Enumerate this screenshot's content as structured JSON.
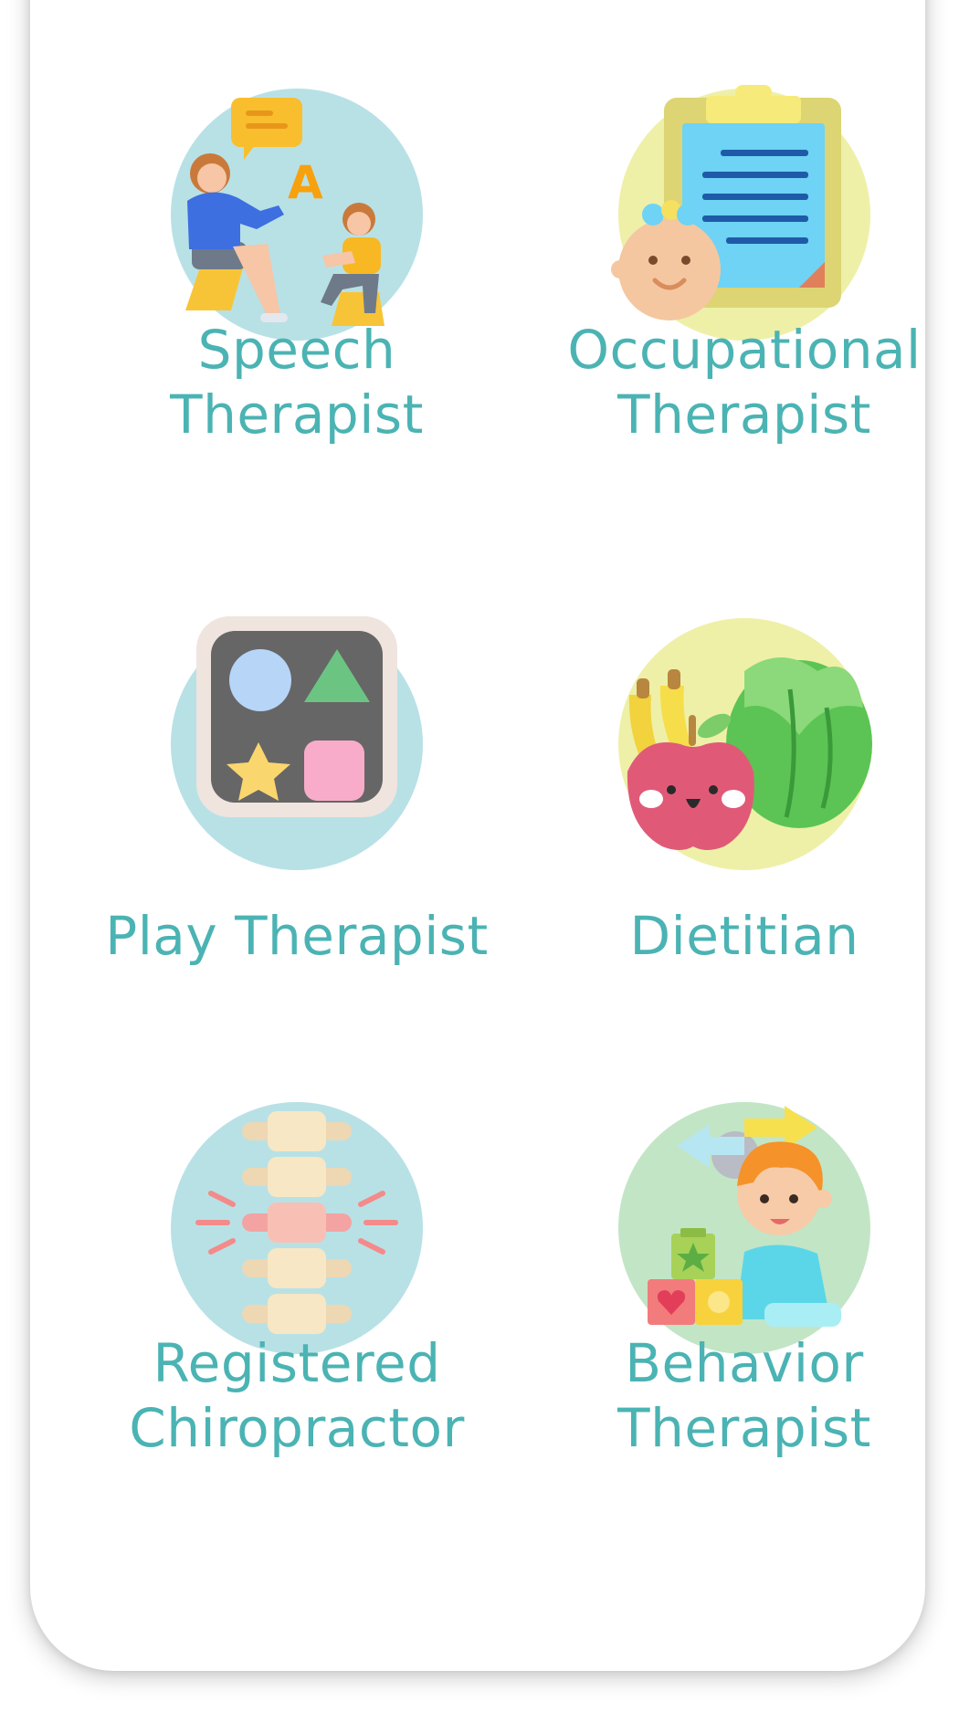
{
  "colors": {
    "label": "#4bb3b3",
    "card": "#ffffff"
  },
  "therapists": [
    {
      "icon": "speech-therapist-icon",
      "line1": "Speech",
      "line2": "Therapist"
    },
    {
      "icon": "occupational-therapist-icon",
      "line1": "Occupational",
      "line2": "Therapist"
    },
    {
      "icon": "play-therapist-icon",
      "line1": "Play Therapist",
      "line2": ""
    },
    {
      "icon": "dietitian-icon",
      "line1": "Dietitian",
      "line2": ""
    },
    {
      "icon": "chiropractor-icon",
      "line1": "Registered",
      "line2": "Chiropractor"
    },
    {
      "icon": "behavior-therapist-icon",
      "line1": "Behavior",
      "line2": "Therapist"
    }
  ]
}
